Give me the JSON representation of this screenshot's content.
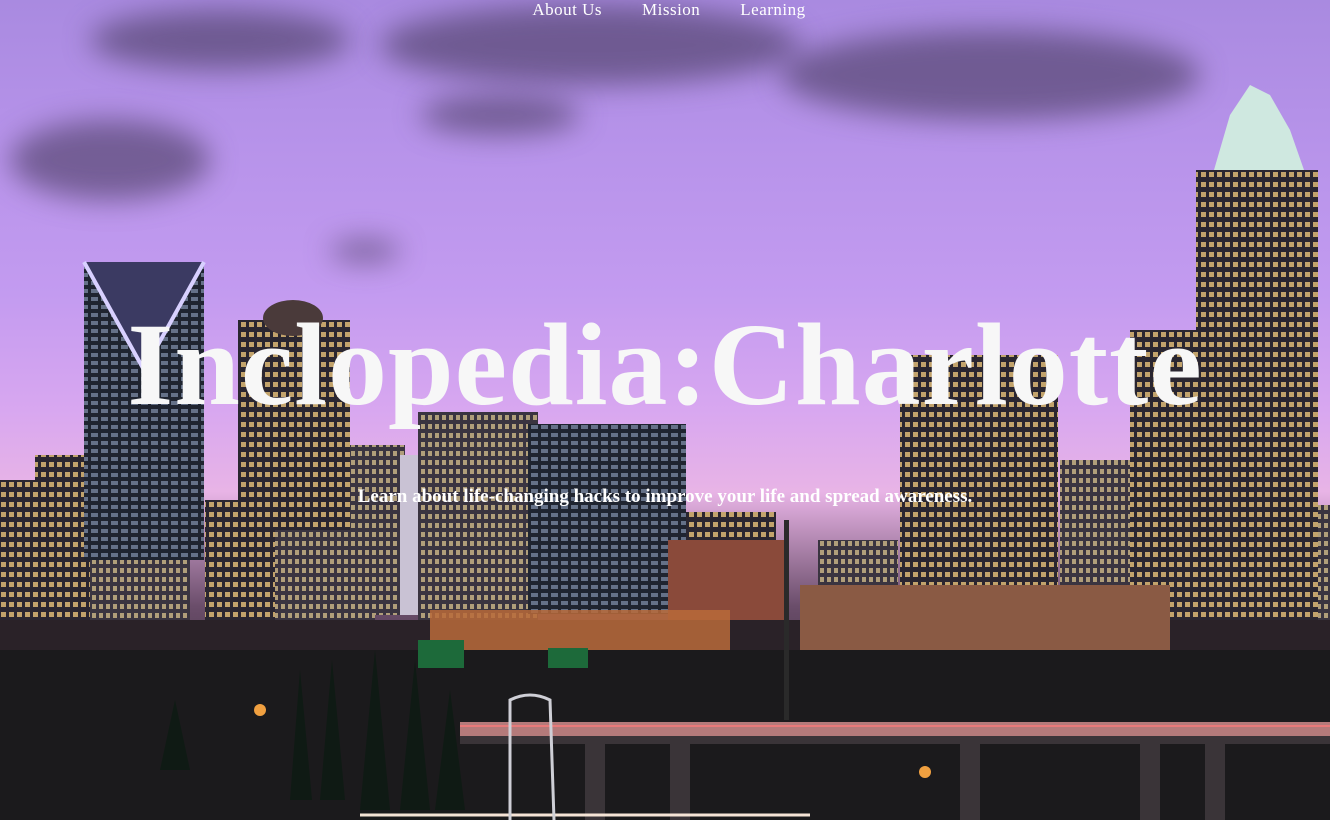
{
  "nav": {
    "items": [
      "About Us",
      "Mission",
      "Learning"
    ]
  },
  "hero": {
    "title": "Inclopedia:Charlotte",
    "subtitle": "Learn about life-changing hacks to improve your life and spread awareness."
  },
  "background": {
    "image": "charlotte-skyline-dusk",
    "sky_color": "#c39bf0",
    "text_color": "#ffffff"
  }
}
